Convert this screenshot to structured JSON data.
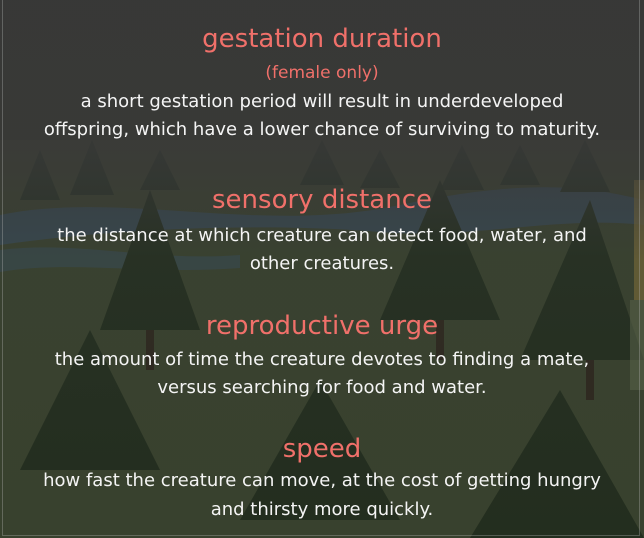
{
  "sections": [
    {
      "heading": "gestation duration",
      "note": "(female only)",
      "line1": "a short gestation period will result in underdeveloped",
      "line2": "offspring, which have a lower chance of surviving to maturity."
    },
    {
      "heading": "sensory distance",
      "line1": "the distance at which creature can detect food, water, and",
      "line2": "other creatures."
    },
    {
      "heading": "reproductive urge",
      "line1": "the amount of time the creature devotes to finding a mate,",
      "line2": "versus searching for food and water."
    },
    {
      "heading": "speed",
      "line1": "how fast the creature can move, at the cost of getting hungry",
      "line2": "and thirsty more quickly."
    }
  ],
  "colors": {
    "heading": "#f0706a",
    "text": "#f4f4f4",
    "panel": "#373737"
  }
}
